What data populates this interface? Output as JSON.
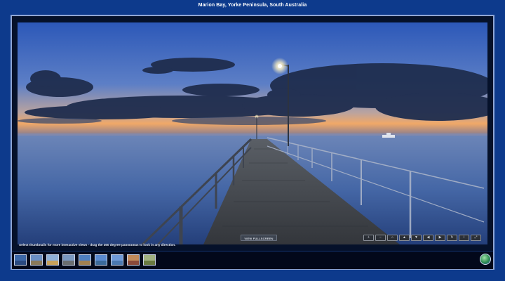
{
  "page": {
    "title": "Marion Bay, Yorke Peninsula, South Australia"
  },
  "viewer": {
    "caption": "Select thumbnails for more interactive views - drag the 360 degree panoramas to look in any direction.",
    "fullscreen_label": "VIEW FULLSCREEN",
    "controls": [
      {
        "icon": "zoom-in-icon",
        "glyph": "+"
      },
      {
        "icon": "zoom-out-icon",
        "glyph": "−"
      },
      {
        "icon": "home-icon",
        "glyph": "⌂"
      },
      {
        "icon": "pan-up-icon",
        "glyph": "▲"
      },
      {
        "icon": "pan-down-icon",
        "glyph": "▼"
      },
      {
        "icon": "pan-left-icon",
        "glyph": "◀"
      },
      {
        "icon": "pan-right-icon",
        "glyph": "▶"
      },
      {
        "icon": "autorotate-icon",
        "glyph": "↻"
      },
      {
        "icon": "info-icon",
        "glyph": "i"
      },
      {
        "icon": "fullscreen-icon",
        "glyph": "⤢"
      }
    ]
  },
  "thumbnails": [
    {
      "sky": "#3d68a8",
      "ground": "#2a4a80"
    },
    {
      "sky": "#6b8fc4",
      "ground": "#8a7a5a"
    },
    {
      "sky": "#8fb0d8",
      "ground": "#c9a25a"
    },
    {
      "sky": "#7a98c0",
      "ground": "#6a6e70"
    },
    {
      "sky": "#4f7fc0",
      "ground": "#a08050"
    },
    {
      "sky": "#5a8ad0",
      "ground": "#3b6a9a"
    },
    {
      "sky": "#6f9ad8",
      "ground": "#4a78b0"
    },
    {
      "sky": "#c08a5a",
      "ground": "#8a4a3a"
    },
    {
      "sky": "#a0b080",
      "ground": "#6a7a40"
    }
  ],
  "colors": {
    "background": "#0d3a8c",
    "frame_border": "#8fa6d4"
  }
}
